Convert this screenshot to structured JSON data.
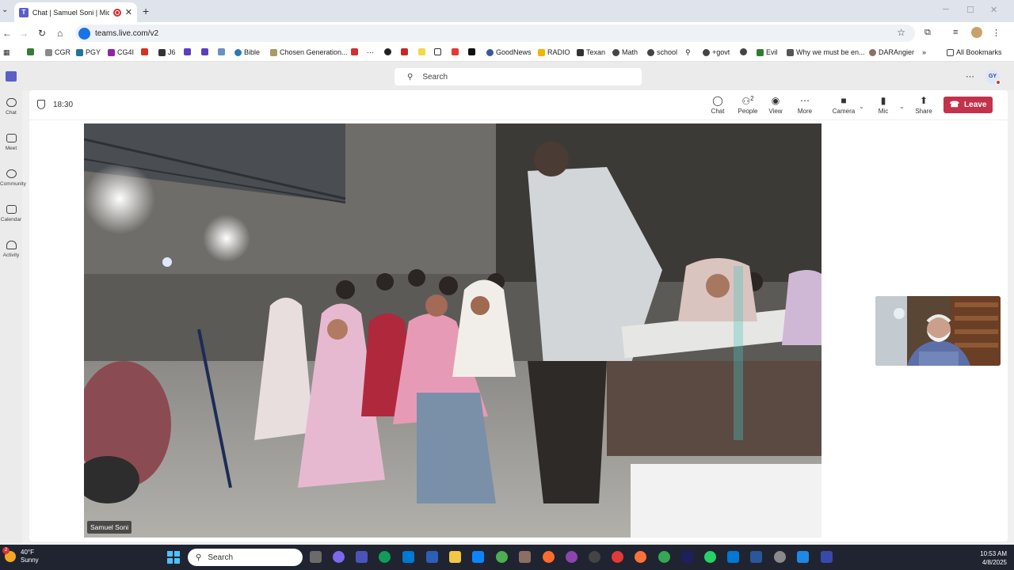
{
  "browser": {
    "tab_title": "Chat | Samuel Soni | Microsoft Teams",
    "url": "teams.live.com/v2",
    "bookmarks": [
      "CGR",
      "PGY",
      "CG4I",
      "J6",
      "Bible",
      "Chosen Generation...",
      "GoodNews",
      "RADIO",
      "Texan",
      "Math",
      "school",
      "+govt",
      "Evil",
      "Why we must be en...",
      "DARAngier"
    ],
    "all_bookmarks_label": "All Bookmarks"
  },
  "teams": {
    "search_placeholder": "Search",
    "avatar_initials": "GY",
    "rail": [
      {
        "label": "Chat",
        "icon": "chat-icon"
      },
      {
        "label": "Meet",
        "icon": "video-icon"
      },
      {
        "label": "Community",
        "icon": "community-icon"
      },
      {
        "label": "Calendar",
        "icon": "calendar-icon"
      },
      {
        "label": "Activity",
        "icon": "bell-icon"
      }
    ]
  },
  "meeting": {
    "timer": "18:30",
    "controls": {
      "chat": "Chat",
      "people": "People",
      "people_count": "2",
      "view": "View",
      "more": "More",
      "camera": "Camera",
      "mic": "Mic",
      "share": "Share",
      "leave": "Leave"
    },
    "participant_name": "Samuel Soni"
  },
  "taskbar": {
    "weather_temp": "40°F",
    "weather_cond": "Sunny",
    "weather_badge": "2",
    "search_label": "Search",
    "time": "10:53 AM",
    "date": "4/8/2025"
  },
  "colors": {
    "leave_button": "#c4314b",
    "teams_brand": "#5b5fc7",
    "taskbar": "#1f2430"
  }
}
